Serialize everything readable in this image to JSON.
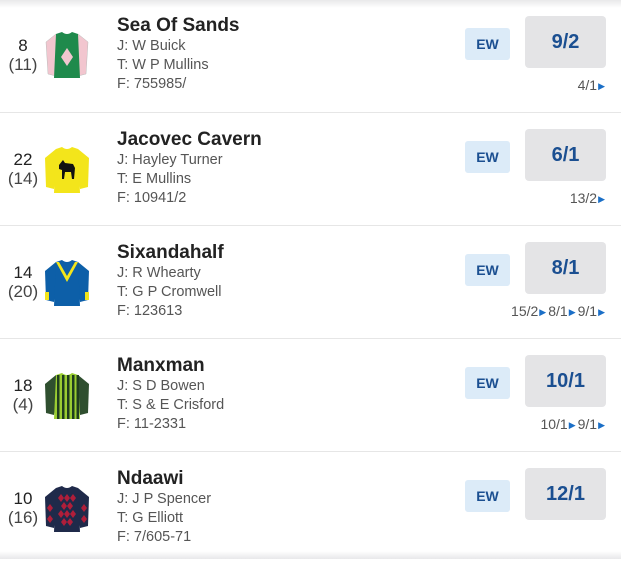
{
  "runners": [
    {
      "number": "8",
      "draw": "(11)",
      "name": "Sea Of Sands",
      "jockey": "J: W Buick",
      "trainer": "T: W P Mullins",
      "form": "F: 755985/",
      "ew_label": "EW",
      "odds": "9/2",
      "history": [
        "4/1"
      ],
      "silk_colors": {
        "body": "#1f8a4c",
        "sleeves": "#f2c6cf",
        "emblem": "#f2c6cf"
      }
    },
    {
      "number": "22",
      "draw": "(14)",
      "name": "Jacovec Cavern",
      "jockey": "J: Hayley Turner",
      "trainer": "T: E Mullins",
      "form": "F: 10941/2",
      "ew_label": "EW",
      "odds": "6/1",
      "history": [
        "13/2"
      ],
      "silk_colors": {
        "body": "#f3e51b",
        "sleeves": "#f3e51b",
        "emblem": "#111111"
      }
    },
    {
      "number": "14",
      "draw": "(20)",
      "name": "Sixandahalf",
      "jockey": "J: R Whearty",
      "trainer": "T: G P Cromwell",
      "form": "F: 123613",
      "ew_label": "EW",
      "odds": "8/1",
      "history": [
        "15/2",
        "8/1",
        "9/1"
      ],
      "silk_colors": {
        "body": "#0d5fa8",
        "sleeves": "#0d5fa8",
        "emblem": "#f3e51b"
      }
    },
    {
      "number": "18",
      "draw": "(4)",
      "name": "Manxman",
      "jockey": "J: S D Bowen",
      "trainer": "T: S & E Crisford",
      "form": "F: 11-2331",
      "ew_label": "EW",
      "odds": "10/1",
      "history": [
        "10/1",
        "9/1"
      ],
      "silk_colors": {
        "body": "#9acd32",
        "sleeves": "#2f4f2f",
        "emblem": "#1f3d1f"
      }
    },
    {
      "number": "10",
      "draw": "(16)",
      "name": "Ndaawi",
      "jockey": "J: J P Spencer",
      "trainer": "T: G Elliott",
      "form": "F: 7/605-71",
      "ew_label": "EW",
      "odds": "12/1",
      "history": [],
      "silk_colors": {
        "body": "#1f2a4a",
        "sleeves": "#1f2a4a",
        "emblem": "#b01e3a"
      }
    }
  ]
}
